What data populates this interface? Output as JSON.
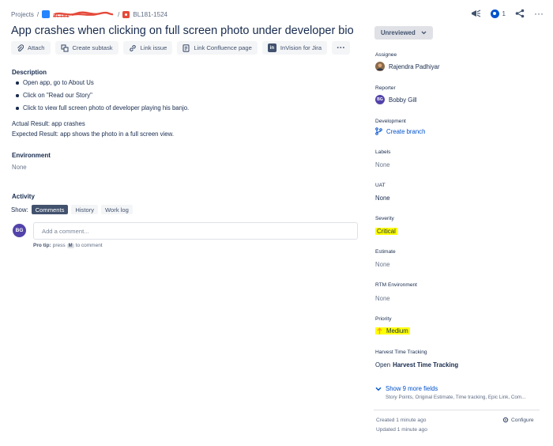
{
  "breadcrumb": {
    "root": "Projects",
    "project_key": "BL181",
    "issue_key": "BL181-1524"
  },
  "header": {
    "watch_count": "1"
  },
  "issue": {
    "title": "App crashes when clicking on full screen photo under developer bio"
  },
  "toolbar": {
    "attach": "Attach",
    "create_subtask": "Create subtask",
    "link_issue": "Link issue",
    "link_confluence": "Link Confluence page",
    "invision_badge": "in",
    "invision": "InVision for Jira",
    "more": "···"
  },
  "description": {
    "heading": "Description",
    "steps": [
      "Open app, go to About Us",
      "Click on \"Read our Story\"",
      "Click to view full screen photo of developer playing his banjo."
    ],
    "actual": "Actual Result: app crashes",
    "expected": "Expected Result: app shows the photo in a full screen view."
  },
  "environment": {
    "heading": "Environment",
    "value": "None"
  },
  "activity": {
    "heading": "Activity",
    "show_label": "Show:",
    "tabs": [
      "Comments",
      "History",
      "Work log"
    ],
    "active_tab": "Comments",
    "user_initials": "BG",
    "comment_placeholder": "Add a comment...",
    "protip_prefix": "Pro tip:",
    "protip_press": "press",
    "protip_key": "M",
    "protip_suffix": "to comment"
  },
  "sidebar": {
    "status": "Unreviewed",
    "assignee_label": "Assignee",
    "assignee": "Rajendra Padhiyar",
    "reporter_label": "Reporter",
    "reporter_initials": "BG",
    "reporter": "Bobby Gill",
    "development_label": "Development",
    "development_action": "Create branch",
    "labels_label": "Labels",
    "labels_value": "None",
    "uat_label": "UAT",
    "uat_value": "None",
    "severity_label": "Severity",
    "severity_value": "Critical",
    "estimate_label": "Estimate",
    "estimate_value": "None",
    "rtm_label": "RTM Environment",
    "rtm_value": "None",
    "priority_label": "Priority",
    "priority_value": "Medium",
    "harvest_label": "Harvest Time Tracking",
    "harvest_prefix": "Open",
    "harvest_value": "Harvest Time Tracking",
    "more_fields": "Show 9 more fields",
    "more_fields_sub": "Story Points, Original Estimate, Time tracking, Epic Link, Com...",
    "created": "Created 1 minute ago",
    "updated": "Updated 1 minute ago",
    "configure": "Configure"
  },
  "colors": {
    "primary_blue": "#0052CC",
    "highlight": "#FFFF00",
    "priority_arrow": "#FF991F",
    "bug_icon": "#E5493A",
    "text": "#172B4D"
  }
}
